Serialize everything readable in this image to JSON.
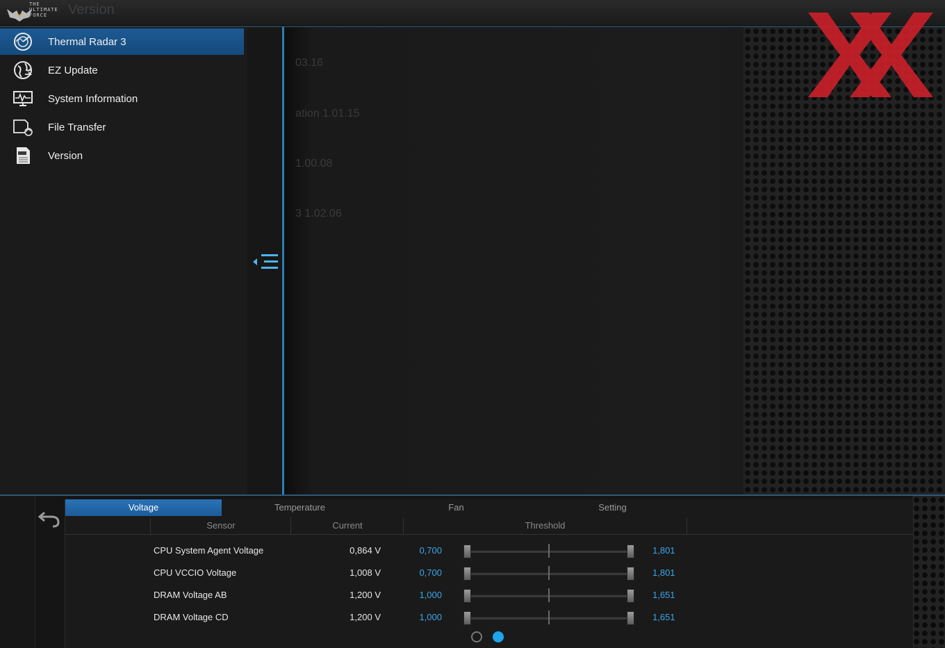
{
  "titlebar": {
    "logo_lines": [
      "THE",
      "ULTIMATE",
      "FORCE"
    ],
    "title": "Version"
  },
  "sidebar": {
    "items": [
      {
        "label": "Thermal Radar 3",
        "icon": "radar-icon",
        "active": true
      },
      {
        "label": "EZ Update",
        "icon": "globe-update-icon",
        "active": false
      },
      {
        "label": "System Information",
        "icon": "monitor-pulse-icon",
        "active": false
      },
      {
        "label": "File Transfer",
        "icon": "file-transfer-icon",
        "active": false
      },
      {
        "label": "Version",
        "icon": "version-document-icon",
        "active": false
      }
    ]
  },
  "main": {
    "ghost_lines": [
      "03.16",
      "ation   1.01.15",
      "1.00.08",
      "3    1.02.06"
    ]
  },
  "tabs": [
    {
      "label": "Voltage",
      "active": true
    },
    {
      "label": "Temperature",
      "active": false
    },
    {
      "label": "Fan",
      "active": false
    },
    {
      "label": "Setting",
      "active": false
    }
  ],
  "table": {
    "headers": {
      "sensor": "Sensor",
      "current": "Current",
      "threshold": "Threshold"
    },
    "rows": [
      {
        "sensor": "CPU System Agent Voltage",
        "current": "0,864 V",
        "min": "0,700",
        "max": "1,801"
      },
      {
        "sensor": "CPU VCCIO Voltage",
        "current": "1,008 V",
        "min": "0,700",
        "max": "1,801"
      },
      {
        "sensor": "DRAM Voltage AB",
        "current": "1,200 V",
        "min": "1,000",
        "max": "1,651"
      },
      {
        "sensor": "DRAM Voltage CD",
        "current": "1,200 V",
        "min": "1,000",
        "max": "1,651"
      }
    ]
  },
  "pager": {
    "pages": 2,
    "current": 2
  },
  "colors": {
    "accent": "#1fa3ec",
    "active_tab": "#2a73b8",
    "watermark": "#c8202a"
  }
}
